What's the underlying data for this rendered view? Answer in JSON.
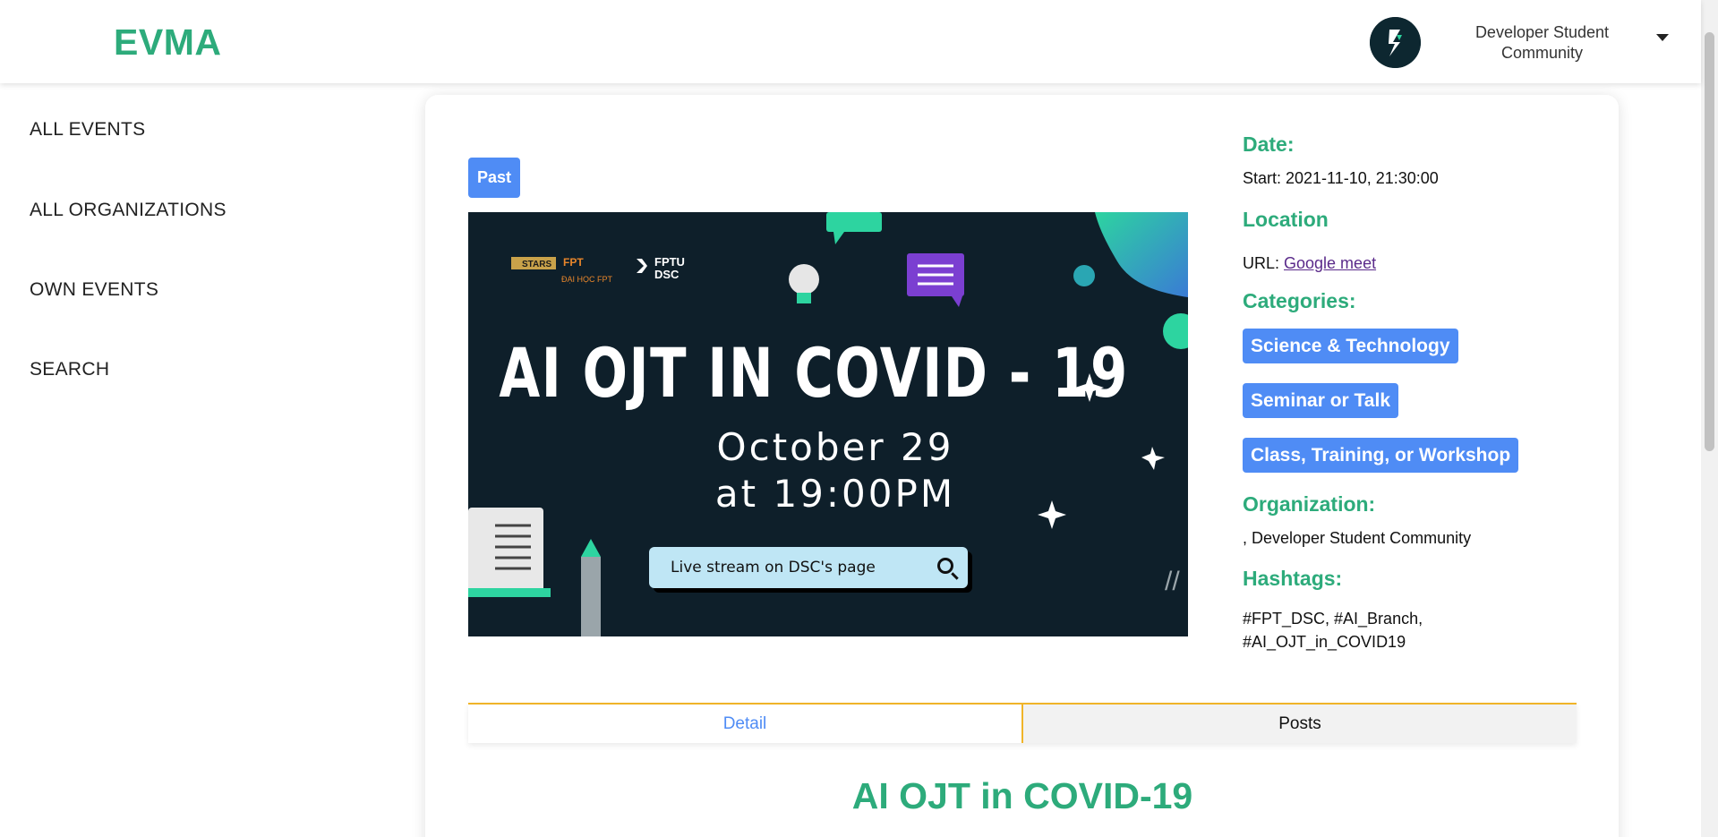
{
  "header": {
    "logo": "EVMA",
    "org_name": "Developer Student Community",
    "colors": {
      "brand": "#2dab7b",
      "avatar_bg": "#0d2730"
    }
  },
  "sidebar": {
    "items": [
      {
        "label": "ALL EVENTS"
      },
      {
        "label": "ALL ORGANIZATIONS"
      },
      {
        "label": "OWN EVENTS"
      },
      {
        "label": "SEARCH"
      }
    ]
  },
  "event": {
    "status_badge": "Past",
    "banner": {
      "logos": [
        "STARS",
        "FPT Education",
        "ĐẠI HỌC FPT",
        "FPTU DSC"
      ],
      "title": "AI OJT IN COVID - 19",
      "date_line": "October 29",
      "time_line": "at 19:00PM",
      "stream_button": "Live stream on DSC's page"
    },
    "date_heading": "Date:",
    "start_prefix": "Start: ",
    "start_value": "2021-11-10, 21:30:00",
    "location_heading": "Location",
    "url_prefix": "URL: ",
    "url_link": "Google meet",
    "categories_heading": "Categories:",
    "categories": [
      "Science & Technology",
      "Seminar or Talk",
      "Class, Training, or Workshop"
    ],
    "organization_heading": "Organization:",
    "organization_value": ", Developer Student Community",
    "hashtags_heading": "Hashtags:",
    "hashtags_line1": "#FPT_DSC, #AI_Branch,",
    "hashtags_line2": "#AI_OJT_in_COVID19",
    "tabs": [
      {
        "label": "Detail"
      },
      {
        "label": "Posts"
      }
    ],
    "title": "AI OJT in COVID-19",
    "colors": {
      "accent": "#4f8cf5",
      "tab_border": "#f0b429",
      "heading": "#2dab7b"
    }
  }
}
